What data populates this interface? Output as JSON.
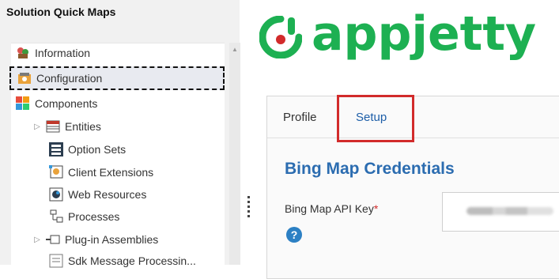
{
  "sidebar": {
    "title": "Solution Quick Maps",
    "items": [
      {
        "label": "Information",
        "icon": "information-icon"
      },
      {
        "label": "Configuration",
        "icon": "configuration-icon"
      },
      {
        "label": "Components",
        "icon": "components-icon"
      },
      {
        "label": "Entities",
        "icon": "entities-icon"
      },
      {
        "label": "Option Sets",
        "icon": "option-sets-icon"
      },
      {
        "label": "Client Extensions",
        "icon": "client-extensions-icon"
      },
      {
        "label": "Web Resources",
        "icon": "web-resources-icon"
      },
      {
        "label": "Processes",
        "icon": "processes-icon"
      },
      {
        "label": "Plug-in Assemblies",
        "icon": "plugin-assemblies-icon"
      },
      {
        "label": "Sdk Message Processin...",
        "icon": "sdk-message-icon"
      }
    ],
    "selected": "Configuration"
  },
  "brand": {
    "name": "appjetty",
    "color": "#1db052",
    "dot_color": "#d22b2b"
  },
  "tabs": [
    {
      "label": "Profile",
      "active": false
    },
    {
      "label": "Setup",
      "active": true
    }
  ],
  "section": {
    "title": "Bing Map Credentials"
  },
  "form": {
    "api_key_label": "Bing Map API Key",
    "required_marker": "*",
    "help_glyph": "?"
  }
}
